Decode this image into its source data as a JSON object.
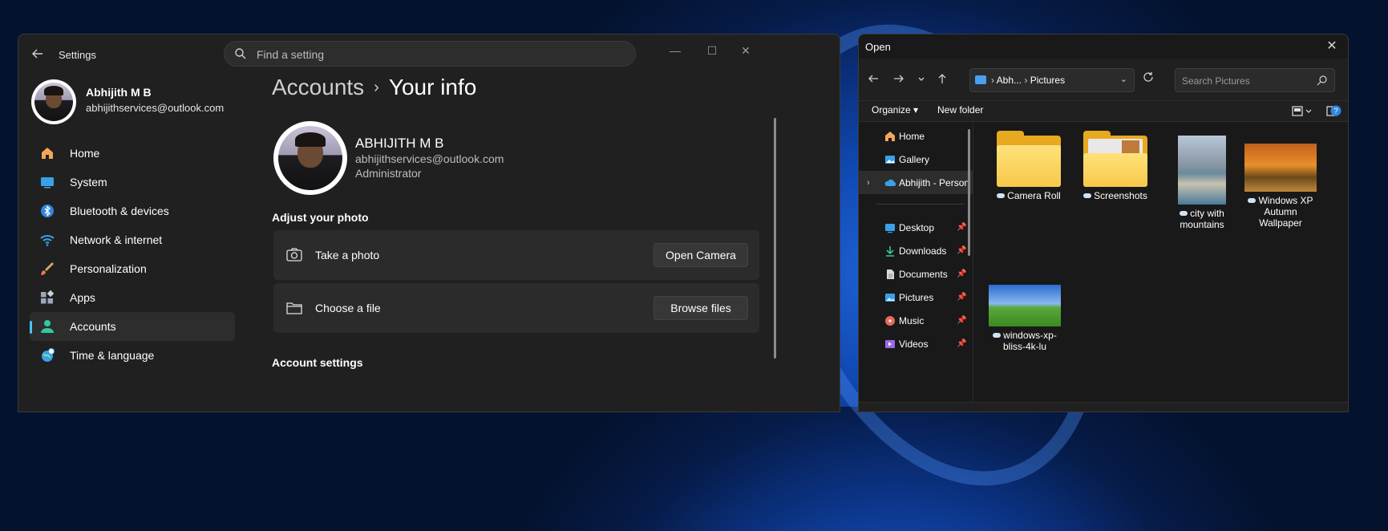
{
  "settings": {
    "app_title": "Settings",
    "search_placeholder": "Find a setting",
    "window_controls": {
      "minimize": "—",
      "maximize": "☐",
      "close": "✕"
    },
    "profile": {
      "name": "Abhijith M B",
      "email": "abhijithservices@outlook.com"
    },
    "nav": [
      {
        "label": "Home",
        "icon": "home-icon"
      },
      {
        "label": "System",
        "icon": "system-icon"
      },
      {
        "label": "Bluetooth & devices",
        "icon": "bluetooth-icon"
      },
      {
        "label": "Network & internet",
        "icon": "network-icon"
      },
      {
        "label": "Personalization",
        "icon": "brush-icon"
      },
      {
        "label": "Apps",
        "icon": "apps-icon"
      },
      {
        "label": "Accounts",
        "icon": "accounts-icon",
        "active": true
      },
      {
        "label": "Time & language",
        "icon": "globe-icon"
      }
    ],
    "breadcrumb": {
      "parent": "Accounts",
      "separator": "›",
      "current": "Your info"
    },
    "user": {
      "name": "ABHIJITH M B",
      "email": "abhijithservices@outlook.com",
      "role": "Administrator"
    },
    "adjust_photo_title": "Adjust your photo",
    "cards": [
      {
        "label": "Take a photo",
        "button": "Open Camera",
        "icon": "camera-icon"
      },
      {
        "label": "Choose a file",
        "button": "Browse files",
        "icon": "folder-icon"
      }
    ],
    "account_settings_title": "Account settings",
    "accent_color": "#4cc2ff"
  },
  "dialog": {
    "title": "Open",
    "close": "✕",
    "address": {
      "root": "Abh...",
      "separator": "›",
      "folder": "Pictures"
    },
    "search_placeholder": "Search Pictures",
    "commands": {
      "organize": "Organize ▾",
      "new_folder": "New folder"
    },
    "tree": [
      {
        "label": "Home",
        "icon": "home-icon",
        "pinned": false
      },
      {
        "label": "Gallery",
        "icon": "gallery-icon",
        "pinned": false
      },
      {
        "label": "Abhijith - Personal",
        "icon": "onedrive-icon",
        "pinned": false,
        "selected": true,
        "expandable": true
      },
      {
        "label": "Desktop",
        "icon": "desktop-icon",
        "pinned": true
      },
      {
        "label": "Downloads",
        "icon": "download-icon",
        "pinned": true
      },
      {
        "label": "Documents",
        "icon": "documents-icon",
        "pinned": true
      },
      {
        "label": "Pictures",
        "icon": "pictures-icon",
        "pinned": true
      },
      {
        "label": "Music",
        "icon": "music-icon",
        "pinned": true
      },
      {
        "label": "Videos",
        "icon": "videos-icon",
        "pinned": true
      }
    ],
    "files": [
      {
        "name": "Camera Roll",
        "kind": "folder"
      },
      {
        "name": "Screenshots",
        "kind": "folder"
      },
      {
        "name": "city with mountains",
        "kind": "image"
      },
      {
        "name": "Windows XP Autumn Wallpaper",
        "kind": "image"
      },
      {
        "name": "windows-xp-bliss-4k-lu",
        "kind": "image"
      }
    ]
  }
}
